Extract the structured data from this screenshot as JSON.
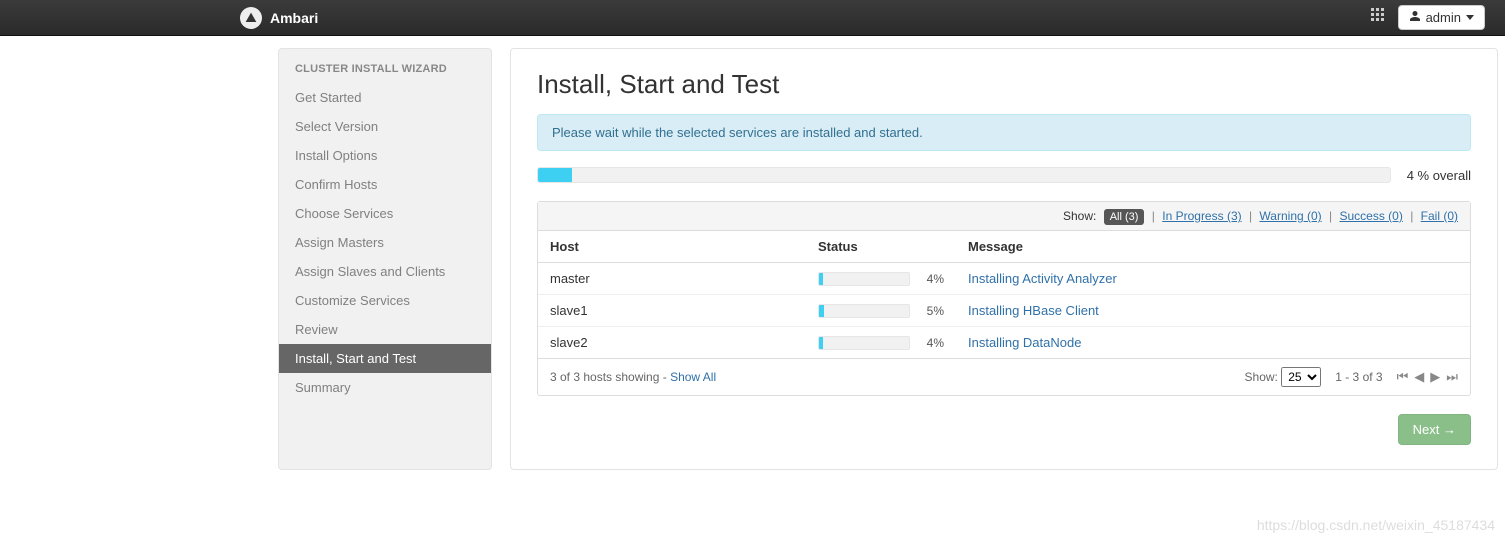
{
  "navbar": {
    "brand": "Ambari",
    "admin_label": "admin"
  },
  "sidebar": {
    "title": "CLUSTER INSTALL WIZARD",
    "items": [
      {
        "label": "Get Started",
        "active": false
      },
      {
        "label": "Select Version",
        "active": false
      },
      {
        "label": "Install Options",
        "active": false
      },
      {
        "label": "Confirm Hosts",
        "active": false
      },
      {
        "label": "Choose Services",
        "active": false
      },
      {
        "label": "Assign Masters",
        "active": false
      },
      {
        "label": "Assign Slaves and Clients",
        "active": false
      },
      {
        "label": "Customize Services",
        "active": false
      },
      {
        "label": "Review",
        "active": false
      },
      {
        "label": "Install, Start and Test",
        "active": true
      },
      {
        "label": "Summary",
        "active": false
      }
    ]
  },
  "main": {
    "title": "Install, Start and Test",
    "info_message": "Please wait while the selected services are installed and started.",
    "overall": {
      "percent": 4,
      "text": "4 % overall"
    },
    "filters": {
      "show_label": "Show:",
      "all": "All (3)",
      "in_progress": "In Progress (3)",
      "warning": "Warning (0)",
      "success": "Success (0)",
      "fail": "Fail (0)"
    },
    "columns": {
      "host": "Host",
      "status": "Status",
      "message": "Message"
    },
    "rows": [
      {
        "host": "master",
        "percent": 4,
        "pct_text": "4%",
        "message": "Installing Activity Analyzer"
      },
      {
        "host": "slave1",
        "percent": 5,
        "pct_text": "5%",
        "message": "Installing HBase Client"
      },
      {
        "host": "slave2",
        "percent": 4,
        "pct_text": "4%",
        "message": "Installing DataNode"
      }
    ],
    "footer": {
      "showing_text": "3 of 3 hosts showing - ",
      "show_all": "Show All",
      "show_label": "Show:",
      "page_size": "25",
      "range_text": "1 - 3 of 3"
    },
    "next_label": "Next →"
  },
  "watermark": "https://blog.csdn.net/weixin_45187434"
}
